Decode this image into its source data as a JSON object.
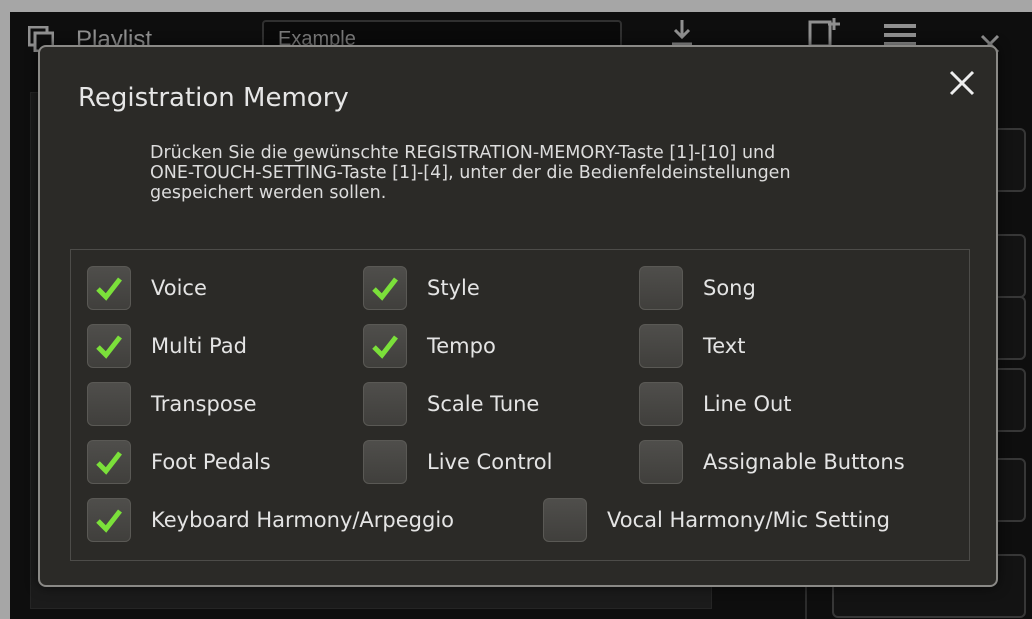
{
  "background": {
    "playlist_title": "Playlist",
    "playlist_field_value": "Example"
  },
  "dialog": {
    "title": "Registration Memory",
    "instruction": "Drücken Sie die gewünschte REGISTRATION-MEMORY-Taste [1]-[10] und\nONE-TOUCH-SETTING-Taste [1]-[4], unter der die Bedienfeldeinstellungen\ngespeichert werden sollen.",
    "options": [
      {
        "label": "Voice",
        "checked": true
      },
      {
        "label": "Style",
        "checked": true
      },
      {
        "label": "Song",
        "checked": false
      },
      {
        "label": "Multi Pad",
        "checked": true
      },
      {
        "label": "Tempo",
        "checked": true
      },
      {
        "label": "Text",
        "checked": false
      },
      {
        "label": "Transpose",
        "checked": false
      },
      {
        "label": "Scale Tune",
        "checked": false
      },
      {
        "label": "Line Out",
        "checked": false
      },
      {
        "label": "Foot Pedals",
        "checked": true
      },
      {
        "label": "Live Control",
        "checked": false
      },
      {
        "label": "Assignable Buttons",
        "checked": false
      },
      {
        "label": "Keyboard Harmony/Arpeggio",
        "checked": true
      },
      {
        "label": "Vocal Harmony/Mic Setting",
        "checked": false
      }
    ]
  },
  "colors": {
    "check_green": "#7be03a",
    "dialog_bg": "#2b2a27",
    "checkbox_bg": "#4a4946"
  },
  "icons": {
    "close": "close-icon",
    "check": "check-icon"
  }
}
